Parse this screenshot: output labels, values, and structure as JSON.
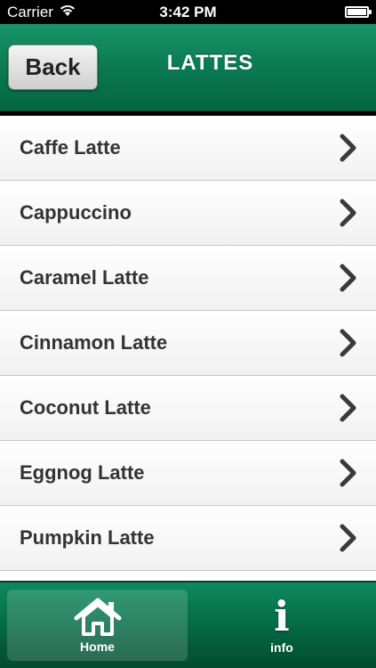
{
  "status_bar": {
    "carrier": "Carrier",
    "time": "3:42 PM",
    "icons": [
      "wifi-icon",
      "battery-icon"
    ]
  },
  "nav": {
    "back_label": "Back",
    "title": "LATTES",
    "accent_color": "#0a7a52"
  },
  "list": {
    "items": [
      {
        "label": "Caffe Latte",
        "icon": "chevron-right-icon"
      },
      {
        "label": "Cappuccino",
        "icon": "chevron-right-icon"
      },
      {
        "label": "Caramel Latte",
        "icon": "chevron-right-icon"
      },
      {
        "label": "Cinnamon Latte",
        "icon": "chevron-right-icon"
      },
      {
        "label": "Coconut Latte",
        "icon": "chevron-right-icon"
      },
      {
        "label": "Eggnog Latte",
        "icon": "chevron-right-icon"
      },
      {
        "label": "Pumpkin Latte",
        "icon": "chevron-right-icon"
      }
    ]
  },
  "tab_bar": {
    "tabs": [
      {
        "label": "Home",
        "icon": "home-icon",
        "active": true
      },
      {
        "label": "info",
        "icon": "info-icon",
        "active": false
      }
    ]
  }
}
